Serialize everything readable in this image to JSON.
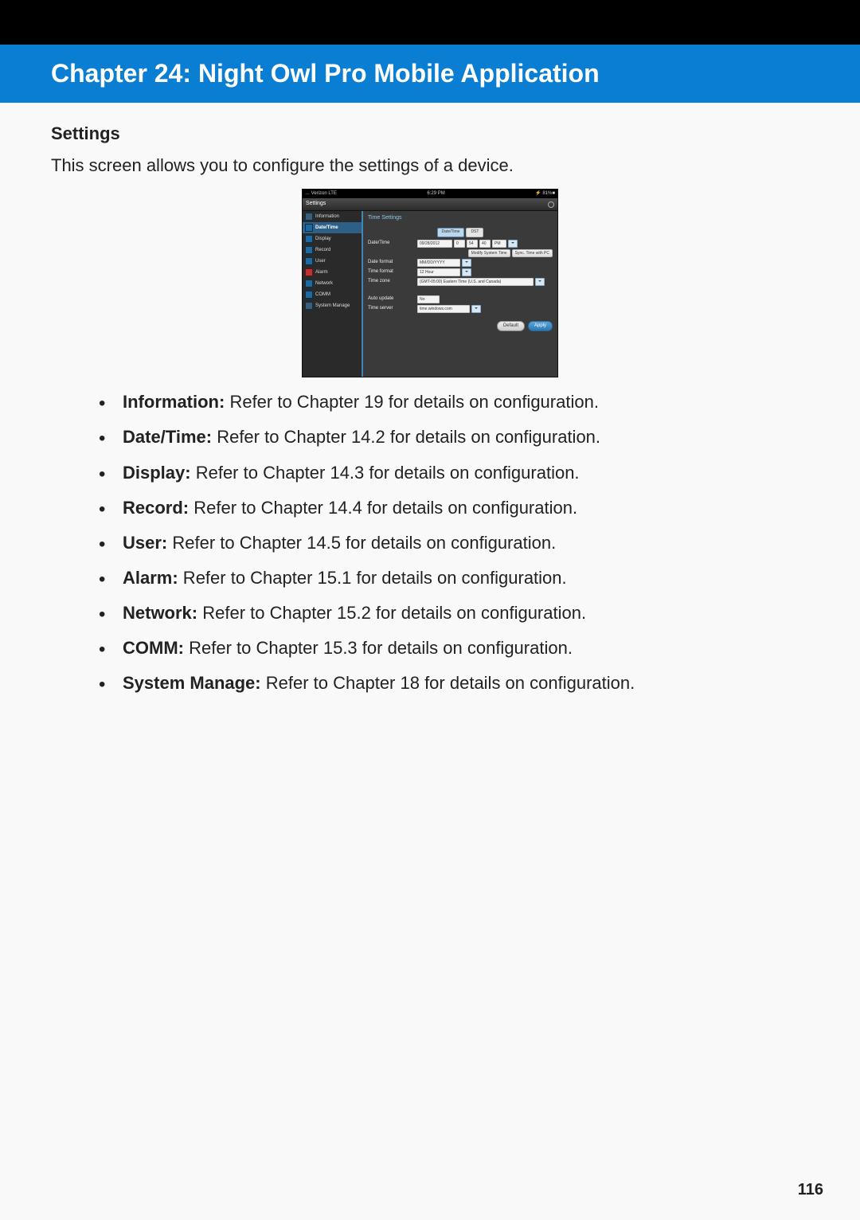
{
  "header": {
    "chapter_title": "Chapter 24: Night Owl Pro Mobile Application"
  },
  "section": {
    "title": "Settings",
    "intro": "This screen allows you to configure the settings of a device."
  },
  "app": {
    "status_left": "… Verizon  LTE",
    "status_center": "6:29 PM",
    "status_right": "⚡ 81%■",
    "header_label": "Settings",
    "sidebar_items": [
      {
        "label": "Information",
        "active": false
      },
      {
        "label": "Date/Time",
        "active": true
      },
      {
        "label": "Display",
        "active": false
      },
      {
        "label": "Record",
        "active": false
      },
      {
        "label": "User",
        "active": false
      },
      {
        "label": "Alarm",
        "active": false
      },
      {
        "label": "Network",
        "active": false
      },
      {
        "label": "COMM",
        "active": false
      },
      {
        "label": "System Manage",
        "active": false
      }
    ],
    "pane": {
      "title": "Time Settings",
      "tabs": {
        "date_time": "Date/Time",
        "dst": "DST"
      },
      "labels": {
        "date_time": "Date/Time",
        "date_format": "Date format",
        "time_format": "Time format",
        "time_zone": "Time zone",
        "auto_update": "Auto update",
        "time_server": "Time server"
      },
      "values": {
        "date": "09/28/2012",
        "time_h": "0",
        "time_m": "54",
        "time_s": "40",
        "ampm": "PM",
        "date_format": "MM/DD/YYYY",
        "time_format": "12 Hour",
        "time_zone": "(GMT-05:00) Eastern Time (U.S. and Canada)",
        "auto_update": "No",
        "time_server": "time.windows.com"
      },
      "buttons": {
        "modify_system_time": "Modify System Time",
        "sync_time_with_pc": "Sync. Time with PC",
        "default": "Default",
        "apply": "Apply"
      }
    }
  },
  "bullets": [
    {
      "label": "Information:",
      "desc": " Refer to Chapter 19 for details on configuration."
    },
    {
      "label": "Date/Time:",
      "desc": " Refer to Chapter 14.2 for details on configuration."
    },
    {
      "label": "Display:",
      "desc": " Refer to Chapter 14.3 for details on configuration."
    },
    {
      "label": "Record:",
      "desc": " Refer to Chapter 14.4 for details on configuration."
    },
    {
      "label": "User:",
      "desc": " Refer to Chapter 14.5 for details on configuration."
    },
    {
      "label": "Alarm:",
      "desc": " Refer to Chapter 15.1 for details on configuration."
    },
    {
      "label": "Network:",
      "desc": " Refer to Chapter 15.2 for details on configuration."
    },
    {
      "label": "COMM:",
      "desc": " Refer to Chapter 15.3 for details on configuration."
    },
    {
      "label": "System Manage:",
      "desc": " Refer to Chapter 18 for details on configuration."
    }
  ],
  "page_number": "116"
}
